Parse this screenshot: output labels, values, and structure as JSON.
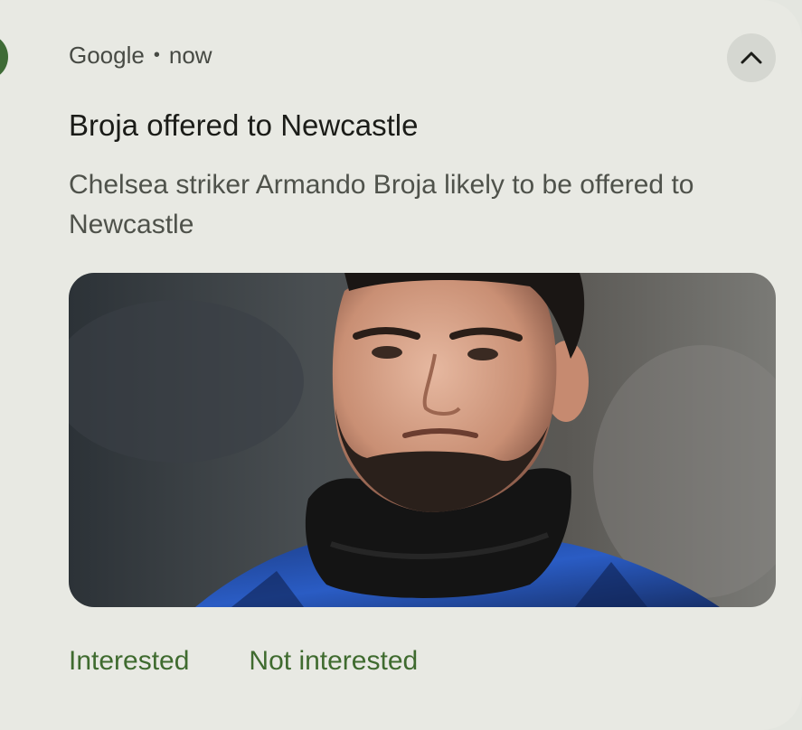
{
  "notification": {
    "app_name": "Google",
    "separator": "•",
    "time": "now",
    "title": "Broja offered to Newcastle",
    "body": "Chelsea striker Armando Broja likely to be offered to Newcastle",
    "app_icon": "news-icon",
    "expand_icon": "chevron-up-icon",
    "actions": {
      "interested": "Interested",
      "not_interested": "Not interested"
    },
    "colors": {
      "card_background": "#e8e9e3",
      "app_icon_background": "#3e6b36",
      "action_text": "#3f6b2f",
      "title_text": "#1b1c18"
    }
  }
}
